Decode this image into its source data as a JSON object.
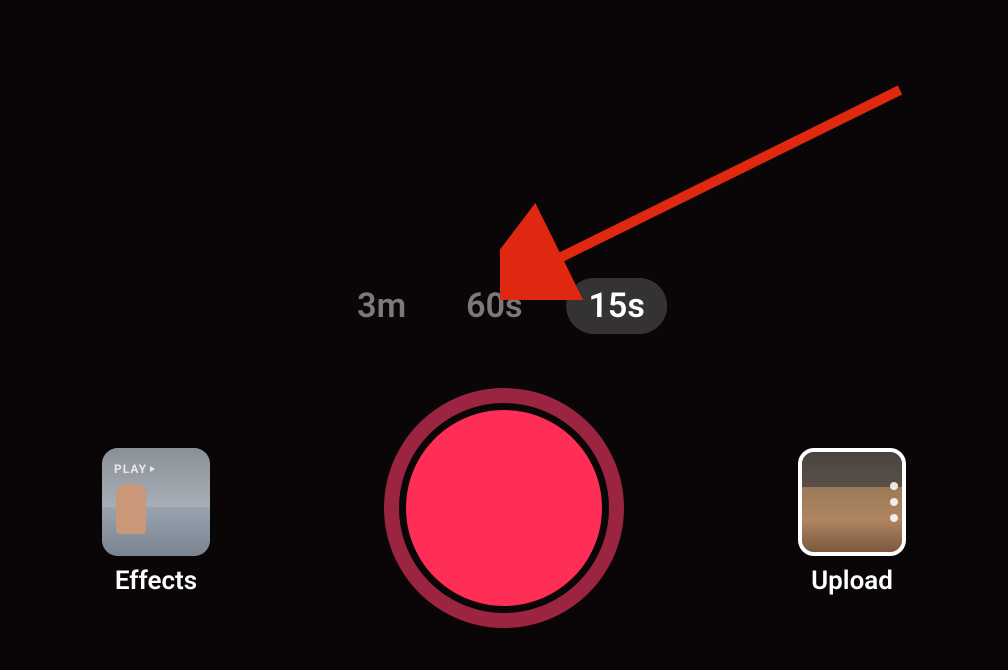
{
  "duration_options": {
    "option_3m": "3m",
    "option_60s": "60s",
    "option_15s": "15s",
    "selected": "15s"
  },
  "effects": {
    "label": "Effects",
    "badge": "PLAY"
  },
  "upload": {
    "label": "Upload"
  }
}
